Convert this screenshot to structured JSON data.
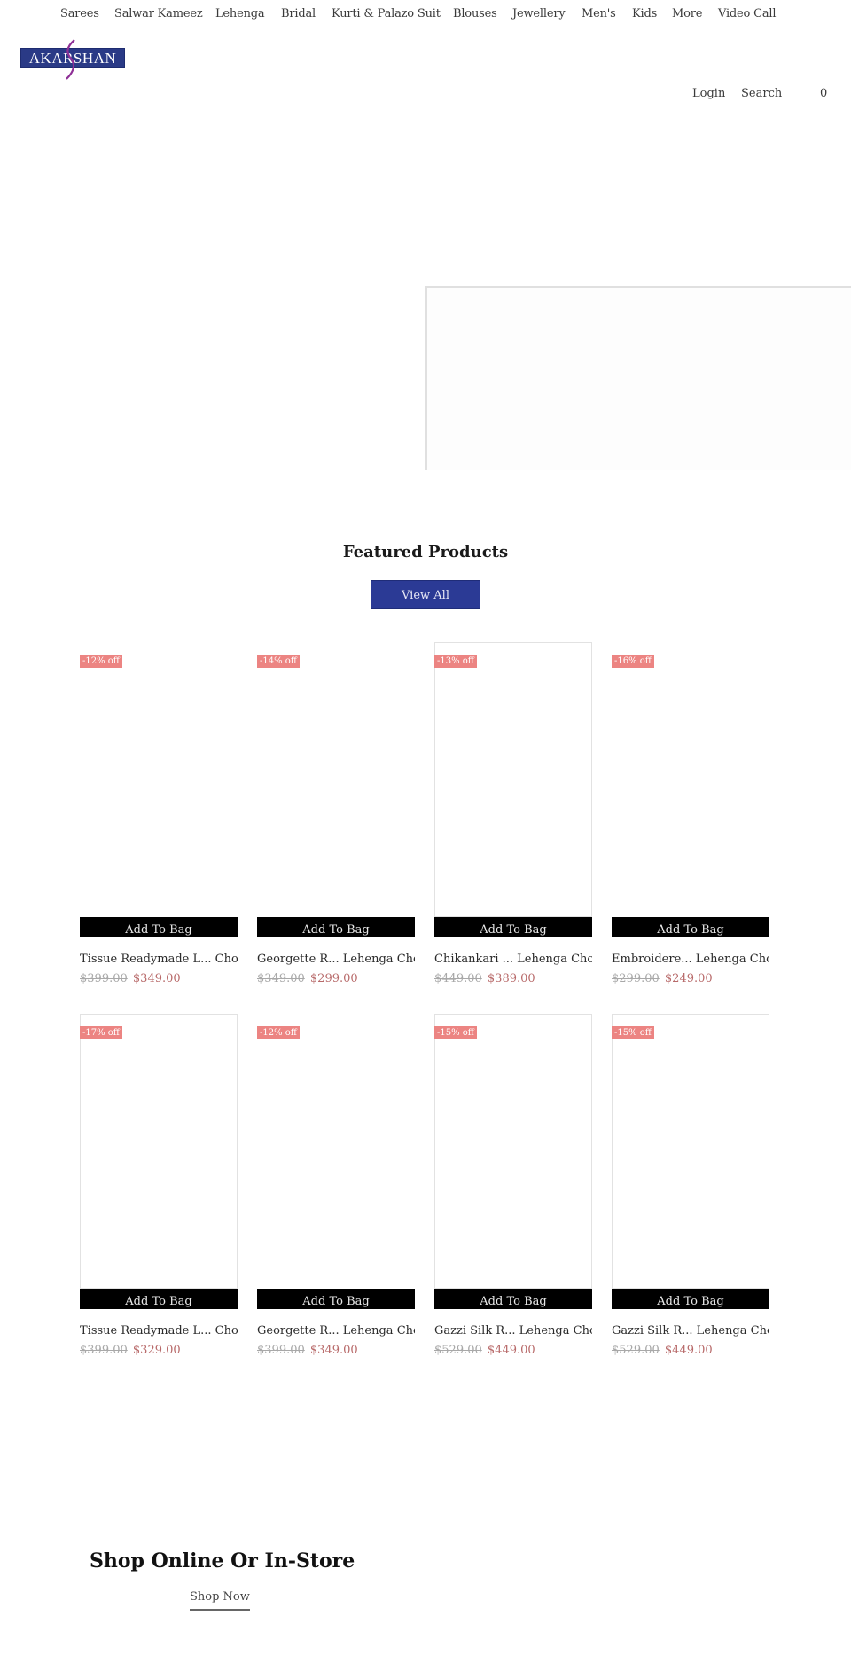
{
  "nav": {
    "items": [
      "Sarees",
      "Salwar Kameez",
      "Lehenga",
      "Bridal",
      "Kurti & Palazo Suit",
      "Blouses",
      "Jewellery",
      "Men's",
      "Kids",
      "More",
      "Video Call"
    ]
  },
  "brand": {
    "logo_text": "AKARSHAN",
    "logo_bg": "#2a3a86",
    "swoosh_color": "#8e2f96"
  },
  "header": {
    "login": "Login",
    "search": "Search",
    "cart_count": "0"
  },
  "featured": {
    "title": "Featured Products",
    "view_all": "View All",
    "accent": "#2b3a95",
    "badge_color": "#ec8482",
    "products": [
      {
        "badge": "-12% off",
        "add_to_bag": "Add To Bag",
        "name": "Tissue Readymade L... Choli",
        "old_price": "$399.00",
        "price": "$349.00"
      },
      {
        "badge": "-14% off",
        "add_to_bag": "Add To Bag",
        "name": "Georgette R... Lehenga Choli",
        "old_price": "$349.00",
        "price": "$299.00"
      },
      {
        "badge": "-13% off",
        "add_to_bag": "Add To Bag",
        "name": "Chikankari ... Lehenga Choli",
        "old_price": "$449.00",
        "price": "$389.00"
      },
      {
        "badge": "-16% off",
        "add_to_bag": "Add To Bag",
        "name": "Embroidere... Lehenga Choli",
        "old_price": "$299.00",
        "price": "$249.00"
      },
      {
        "badge": "-17% off",
        "add_to_bag": "Add To Bag",
        "name": "Tissue Readymade L... Choli",
        "old_price": "$399.00",
        "price": "$329.00"
      },
      {
        "badge": "-12% off",
        "add_to_bag": "Add To Bag",
        "name": "Georgette R... Lehenga Choli",
        "old_price": "$399.00",
        "price": "$349.00"
      },
      {
        "badge": "-15% off",
        "add_to_bag": "Add To Bag",
        "name": "Gazzi Silk R... Lehenga Choli",
        "old_price": "$529.00",
        "price": "$449.00"
      },
      {
        "badge": "-15% off",
        "add_to_bag": "Add To Bag",
        "name": "Gazzi Silk R... Lehenga Choli",
        "old_price": "$529.00",
        "price": "$449.00"
      }
    ]
  },
  "promo": {
    "title": "Shop Online Or In-Store",
    "cta": "Shop Now"
  }
}
